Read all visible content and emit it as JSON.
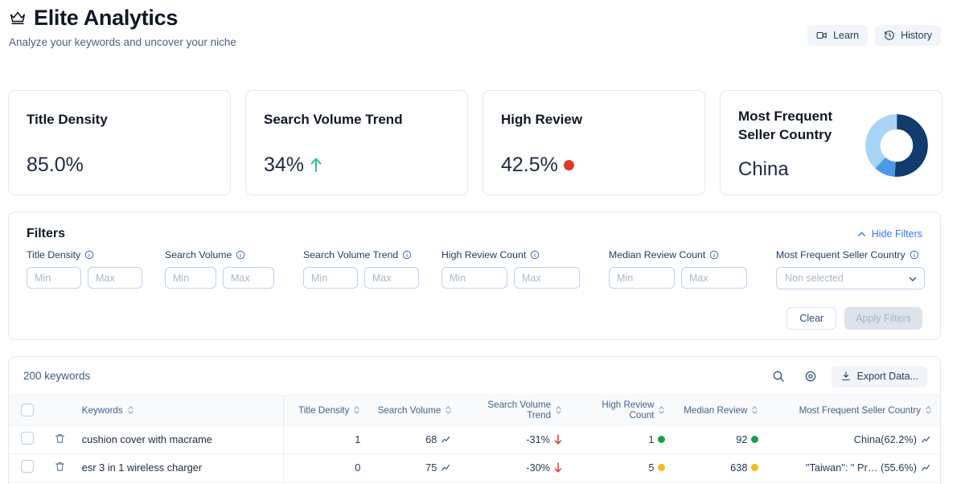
{
  "header": {
    "title": "Elite Analytics",
    "subtitle": "Analyze your keywords and uncover your niche",
    "crown_icon": "crown-icon",
    "actions": [
      {
        "label": "Learn",
        "icon": "video-icon"
      },
      {
        "label": "History",
        "icon": "clock-rewind-icon"
      }
    ]
  },
  "cards": [
    {
      "title": "Title Density",
      "value": "85.0%",
      "indicator": "none"
    },
    {
      "title": "Search Volume Trend",
      "value": "34%",
      "indicator": "arrow-up",
      "indicator_color": "#22c88a"
    },
    {
      "title": "High Review",
      "value": "42.5%",
      "indicator": "dot",
      "indicator_color": "#d93a26"
    },
    {
      "title": "Most Frequent Seller Country",
      "value": "China",
      "indicator": "donut"
    }
  ],
  "donut": {
    "segments": [
      {
        "label": "China",
        "value": 51,
        "color": "#103c6e"
      },
      {
        "label": "segment-2",
        "value": 11,
        "color": "#4a9ae8"
      },
      {
        "label": "segment-3",
        "value": 38,
        "color": "#a8d4f5"
      }
    ]
  },
  "filters": {
    "title": "Filters",
    "hide_label": "Hide Filters",
    "hide_icon": "chevron-up-icon",
    "accent_color": "#2f80ed",
    "fields": [
      {
        "label": "Title Density",
        "info_icon": "info-icon",
        "type": "minmax",
        "min_placeholder": "Min",
        "max_placeholder": "Max",
        "min_value": "",
        "max_value": ""
      },
      {
        "label": "Search Volume",
        "info_icon": "info-icon",
        "type": "minmax",
        "min_placeholder": "Min",
        "max_placeholder": "Max",
        "min_value": "",
        "max_value": ""
      },
      {
        "label": "Search Volume Trend",
        "info_icon": "info-icon",
        "type": "minmax",
        "min_placeholder": "Min",
        "max_placeholder": "Max",
        "min_value": "",
        "max_value": ""
      },
      {
        "label": "High Review Count",
        "info_icon": "info-icon",
        "type": "minmax",
        "min_placeholder": "Min",
        "max_placeholder": "Max",
        "min_value": "",
        "max_value": ""
      },
      {
        "label": "Median Review Count",
        "info_icon": "info-icon",
        "type": "minmax",
        "min_placeholder": "Min",
        "max_placeholder": "Max",
        "min_value": "",
        "max_value": ""
      },
      {
        "label": "Most Frequent Seller Country",
        "info_icon": "info-icon",
        "type": "select",
        "selected": "Non selected",
        "chevron_icon": "chevron-down-icon"
      }
    ],
    "clear_label": "Clear",
    "apply_label": "Apply Filters",
    "apply_disabled": true
  },
  "table": {
    "count_label": "200 keywords",
    "search_icon": "search-icon",
    "settings_icon": "gear-icon",
    "export_label": "Export Data...",
    "export_icon": "download-icon",
    "select_all_checkbox": false,
    "columns": [
      {
        "label": "Keywords",
        "sortable": true
      },
      {
        "label": "Title Density",
        "sortable": true
      },
      {
        "label": "Search Volume",
        "sortable": true
      },
      {
        "label": "Search Volume Trend",
        "sortable": true
      },
      {
        "label": "High Review Count",
        "sortable": true
      },
      {
        "label": "Median Review",
        "sortable": true
      },
      {
        "label": "Most Frequent Seller Country",
        "sortable": true
      }
    ],
    "rows": [
      {
        "checked": false,
        "delete_icon": "trash-icon",
        "keyword": "cushion cover with macrame",
        "title_density": "1",
        "search_volume": "68",
        "search_volume_sparkline": "sparkline-icon",
        "search_volume_trend": "-31%",
        "trend_arrow": "arrow-down-icon",
        "trend_color": "#e2452c",
        "high_review_count": "1",
        "high_review_dot_color": "#1a9e4b",
        "median_review": "92",
        "median_review_dot_color": "#1a9e4b",
        "seller_country": "China(62.2%)",
        "seller_country_sparkline": "sparkline-icon"
      },
      {
        "checked": false,
        "delete_icon": "trash-icon",
        "keyword": "esr 3 in 1 wireless charger",
        "title_density": "0",
        "search_volume": "75",
        "search_volume_sparkline": "sparkline-icon",
        "search_volume_trend": "-30%",
        "trend_arrow": "arrow-down-icon",
        "trend_color": "#e2452c",
        "high_review_count": "5",
        "high_review_dot_color": "#f2bc1b",
        "median_review": "638",
        "median_review_dot_color": "#f2bc1b",
        "seller_country": "\"Taiwan\": \" Pr… (55.6%)",
        "seller_country_sparkline": "sparkline-icon"
      }
    ]
  }
}
